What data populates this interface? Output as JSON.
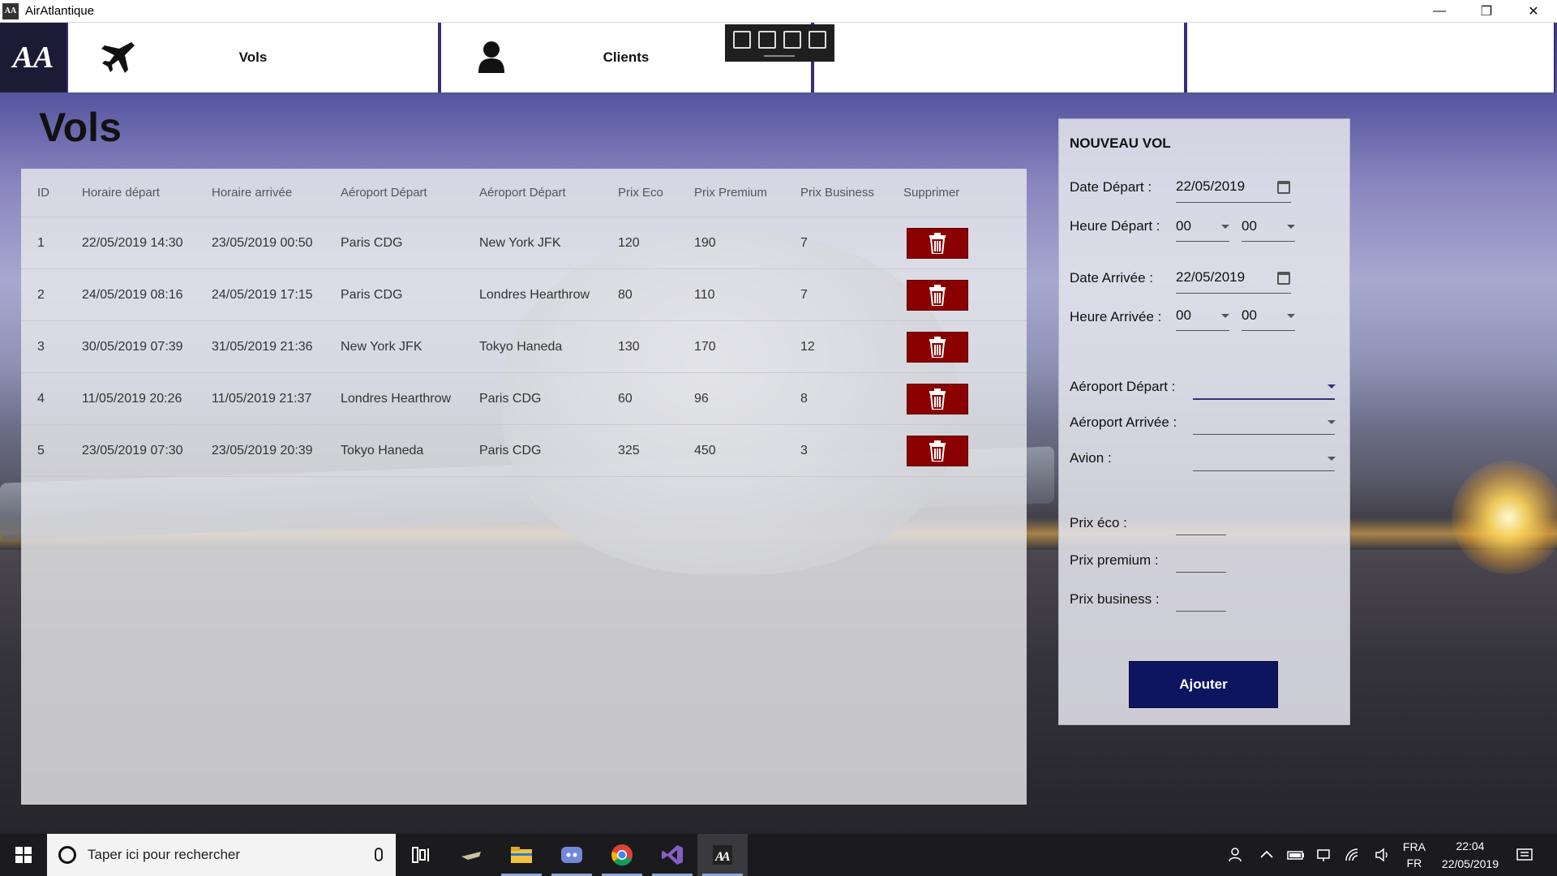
{
  "window": {
    "app_icon": "AA",
    "title": "AirAtlantique",
    "minimize": "—",
    "restore": "❐",
    "close": "✕"
  },
  "nav": {
    "logo": "AA",
    "tabs": [
      {
        "label": "Vols",
        "icon": "airplane-icon"
      },
      {
        "label": "Clients",
        "icon": "person-icon"
      },
      {
        "label": "",
        "icon": ""
      },
      {
        "label": "",
        "icon": ""
      }
    ]
  },
  "page": {
    "title": "Vols"
  },
  "table": {
    "headers": [
      "ID",
      "Horaire départ",
      "Horaire arrivée",
      "Aéroport Départ",
      "Aéroport Départ",
      "Prix Eco",
      "Prix Premium",
      "Prix Business",
      "Supprimer"
    ],
    "rows": [
      [
        "1",
        "22/05/2019 14:30",
        "23/05/2019 00:50",
        "Paris CDG",
        "New York JFK",
        "120",
        "190",
        "7"
      ],
      [
        "2",
        "24/05/2019 08:16",
        "24/05/2019 17:15",
        "Paris CDG",
        "Londres Hearthrow",
        "80",
        "110",
        "7"
      ],
      [
        "3",
        "30/05/2019 07:39",
        "31/05/2019 21:36",
        "New York JFK",
        "Tokyo Haneda",
        "130",
        "170",
        "12"
      ],
      [
        "4",
        "11/05/2019 20:26",
        "11/05/2019 21:37",
        "Londres Hearthrow",
        "Paris CDG",
        "60",
        "96",
        "8"
      ],
      [
        "5",
        "23/05/2019 07:30",
        "23/05/2019 20:39",
        "Tokyo Haneda",
        "Paris CDG",
        "325",
        "450",
        "3"
      ]
    ]
  },
  "form": {
    "title": "NOUVEAU VOL",
    "date_depart_label": "Date Départ :",
    "date_depart_value": "22/05/2019",
    "heure_depart_label": "Heure Départ :",
    "heure_depart_h": "00",
    "heure_depart_m": "00",
    "date_arrivee_label": "Date Arrivée :",
    "date_arrivee_value": "22/05/2019",
    "heure_arrivee_label": "Heure Arrivée :",
    "heure_arrivee_h": "00",
    "heure_arrivee_m": "00",
    "aeroport_depart_label": "Aéroport Départ :",
    "aeroport_arrivee_label": "Aéroport Arrivée :",
    "avion_label": "Avion :",
    "prix_eco_label": "Prix éco :",
    "prix_premium_label": "Prix premium :",
    "prix_business_label": "Prix business :",
    "submit_label": "Ajouter"
  },
  "taskbar": {
    "search_placeholder": "Taper ici pour rechercher",
    "lang_top": "FRA",
    "lang_bottom": "FR",
    "time": "22:04",
    "date": "22/05/2019"
  },
  "colors": {
    "accent": "#3a2d77",
    "delete": "#8b0000",
    "submit": "#0d1560"
  }
}
